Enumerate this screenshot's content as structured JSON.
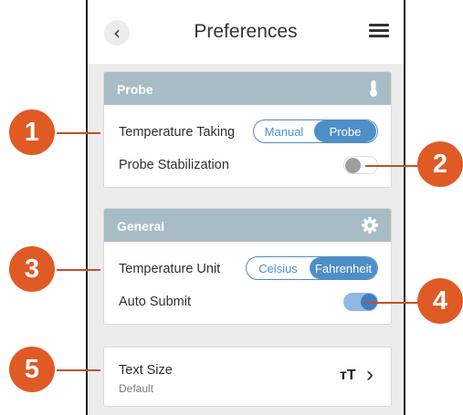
{
  "header": {
    "title": "Preferences",
    "back_glyph": "‹"
  },
  "probe_section": {
    "title": "Probe",
    "icon": "thermometer-icon",
    "temperature_taking": {
      "label": "Temperature Taking",
      "options": [
        "Manual",
        "Probe"
      ],
      "selected": "Probe"
    },
    "probe_stabilization": {
      "label": "Probe Stabilization",
      "enabled": false
    }
  },
  "general_section": {
    "title": "General",
    "icon": "gear-icon",
    "temperature_unit": {
      "label": "Temperature Unit",
      "options": [
        "Celsius",
        "Fahrenheit"
      ],
      "selected": "Fahrenheit"
    },
    "auto_submit": {
      "label": "Auto Submit",
      "enabled": true
    }
  },
  "text_size": {
    "label": "Text Size",
    "value": "Default",
    "icon_glyph": "тT",
    "chevron": "›"
  },
  "callouts": [
    "1",
    "2",
    "3",
    "4",
    "5"
  ],
  "colors": {
    "callout": "#e05a25",
    "header": "#a8bcc5",
    "accent": "#4f8ec7",
    "toggle_on": "#3f7ec2"
  }
}
